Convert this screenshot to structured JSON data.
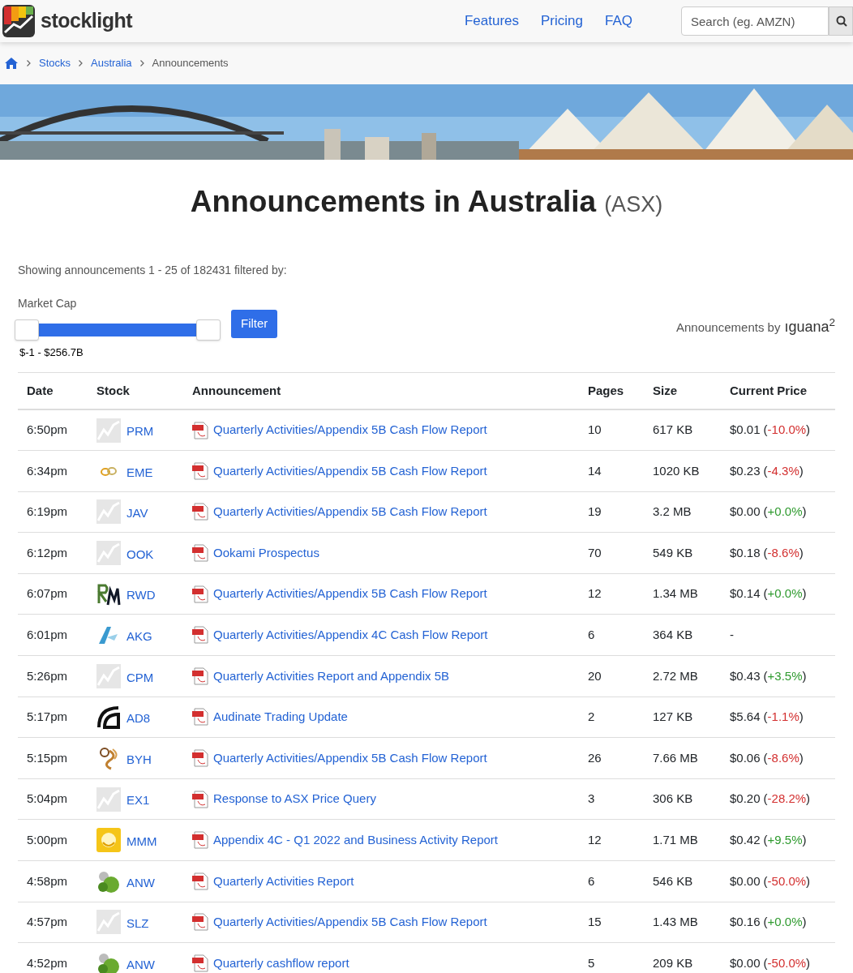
{
  "nav": {
    "brand": "stocklight",
    "links": [
      "Features",
      "Pricing",
      "FAQ"
    ],
    "search": {
      "placeholder": "Search (eg. AMZN)"
    }
  },
  "breadcrumb": {
    "links": [
      "Stocks",
      "Australia"
    ],
    "current": "Announcements"
  },
  "title": {
    "main": "Announcements in Australia",
    "exchange": "(ASX)"
  },
  "summary": "Showing announcements 1 - 25 of 182431 filtered by:",
  "filter": {
    "label": "Market Cap",
    "slider": {
      "level": 1
    },
    "range": "$-1 - $256.7B",
    "button": "Filter"
  },
  "provider": {
    "prefix": "Announcements by",
    "logo": "ıguana$^{2}$"
  },
  "table": {
    "columns": [
      "Date",
      "Stock",
      "Announcement",
      "Pages",
      "Size",
      "Current Price"
    ],
    "rows": [
      {
        "date": "6:50pm",
        "logo": {
          "kind": "generic"
        },
        "stock": "PRM",
        "title": "Quarterly Activities/Appendix 5B Cash Flow Report",
        "pages": "10",
        "size": "617 KB",
        "price": "$0.01",
        "change": {
          "open": "(",
          "value": "-10.0%",
          "close": ")",
          "color": "#d32f2f"
        }
      },
      {
        "date": "6:34pm",
        "logo": {
          "kind": "rings"
        },
        "stock": "EME",
        "title": "Quarterly Activities/Appendix 5B Cash Flow Report",
        "pages": "14",
        "size": "1020 KB",
        "price": "$0.23",
        "change": {
          "open": "(",
          "value": "-4.3%",
          "close": ")",
          "color": "#d32f2f"
        }
      },
      {
        "date": "6:19pm",
        "logo": {
          "kind": "generic"
        },
        "stock": "JAV",
        "title": "Quarterly Activities/Appendix 5B Cash Flow Report",
        "pages": "19",
        "size": "3.2 MB",
        "price": "$0.00",
        "change": {
          "open": "(",
          "value": "+0.0%",
          "close": ")",
          "color": "#2e9a2e"
        }
      },
      {
        "date": "6:12pm",
        "logo": {
          "kind": "generic"
        },
        "stock": "OOK",
        "title": "Ookami Prospectus",
        "pages": "70",
        "size": "549 KB",
        "price": "$0.18",
        "change": {
          "open": "(",
          "value": "-8.6%",
          "close": ")",
          "color": "#d32f2f"
        }
      },
      {
        "date": "6:07pm",
        "logo": {
          "kind": "strokes"
        },
        "stock": "RWD",
        "title": "Quarterly Activities/Appendix 5B Cash Flow Report",
        "pages": "12",
        "size": "1.34 MB",
        "price": "$0.14",
        "change": {
          "open": "(",
          "value": "+0.0%",
          "close": ")",
          "color": "#2e9a2e"
        }
      },
      {
        "date": "6:01pm",
        "logo": {
          "kind": "chevron"
        },
        "stock": "AKG",
        "title": "Quarterly Activities/Appendix 4C Cash Flow Report",
        "pages": "6",
        "size": "364 KB",
        "price": "-"
      },
      {
        "date": "5:26pm",
        "logo": {
          "kind": "generic"
        },
        "stock": "CPM",
        "title": "Quarterly Activities Report and Appendix 5B",
        "pages": "20",
        "size": "2.72 MB",
        "price": "$0.43",
        "change": {
          "open": "(",
          "value": "+3.5%",
          "close": ")",
          "color": "#2e9a2e"
        }
      },
      {
        "date": "5:17pm",
        "logo": {
          "kind": "arc"
        },
        "stock": "AD8",
        "title": "Audinate Trading Update",
        "pages": "2",
        "size": "127 KB",
        "price": "$5.64",
        "change": {
          "open": "(",
          "value": "-1.1%",
          "close": ")",
          "color": "#d32f2f"
        }
      },
      {
        "date": "5:15pm",
        "logo": {
          "kind": "swirl"
        },
        "stock": "BYH",
        "title": "Quarterly Activities/Appendix 5B Cash Flow Report",
        "pages": "26",
        "size": "7.66 MB",
        "price": "$0.06",
        "change": {
          "open": "(",
          "value": "-8.6%",
          "close": ")",
          "color": "#d32f2f"
        }
      },
      {
        "date": "5:04pm",
        "logo": {
          "kind": "generic"
        },
        "stock": "EX1",
        "title": "Response to ASX Price Query",
        "pages": "3",
        "size": "306 KB",
        "price": "$0.20",
        "change": {
          "open": "(",
          "value": "-28.2%",
          "close": ")",
          "color": "#d32f2f"
        }
      },
      {
        "date": "5:00pm",
        "logo": {
          "kind": "badge"
        },
        "stock": "MMM",
        "title": "Appendix 4C - Q1 2022 and Business Activity Report",
        "pages": "12",
        "size": "1.71 MB",
        "price": "$0.42",
        "change": {
          "open": "(",
          "value": "+9.5%",
          "close": ")",
          "color": "#2e9a2e"
        }
      },
      {
        "date": "4:58pm",
        "logo": {
          "kind": "molecule"
        },
        "stock": "ANW",
        "title": "Quarterly Activities Report",
        "pages": "6",
        "size": "546 KB",
        "price": "$0.00",
        "change": {
          "open": "(",
          "value": "-50.0%",
          "close": ")",
          "color": "#d32f2f"
        }
      },
      {
        "date": "4:57pm",
        "logo": {
          "kind": "generic"
        },
        "stock": "SLZ",
        "title": "Quarterly Activities/Appendix 5B Cash Flow Report",
        "pages": "15",
        "size": "1.43 MB",
        "price": "$0.16",
        "change": {
          "open": "(",
          "value": "+0.0%",
          "close": ")",
          "color": "#2e9a2e"
        }
      },
      {
        "date": "4:52pm",
        "logo": {
          "kind": "molecule"
        },
        "stock": "ANW",
        "title": "Quarterly cashflow report",
        "pages": "5",
        "size": "209 KB",
        "price": "$0.00",
        "change": {
          "open": "(",
          "value": "-50.0%",
          "close": ")",
          "color": "#d32f2f"
        }
      }
    ]
  }
}
